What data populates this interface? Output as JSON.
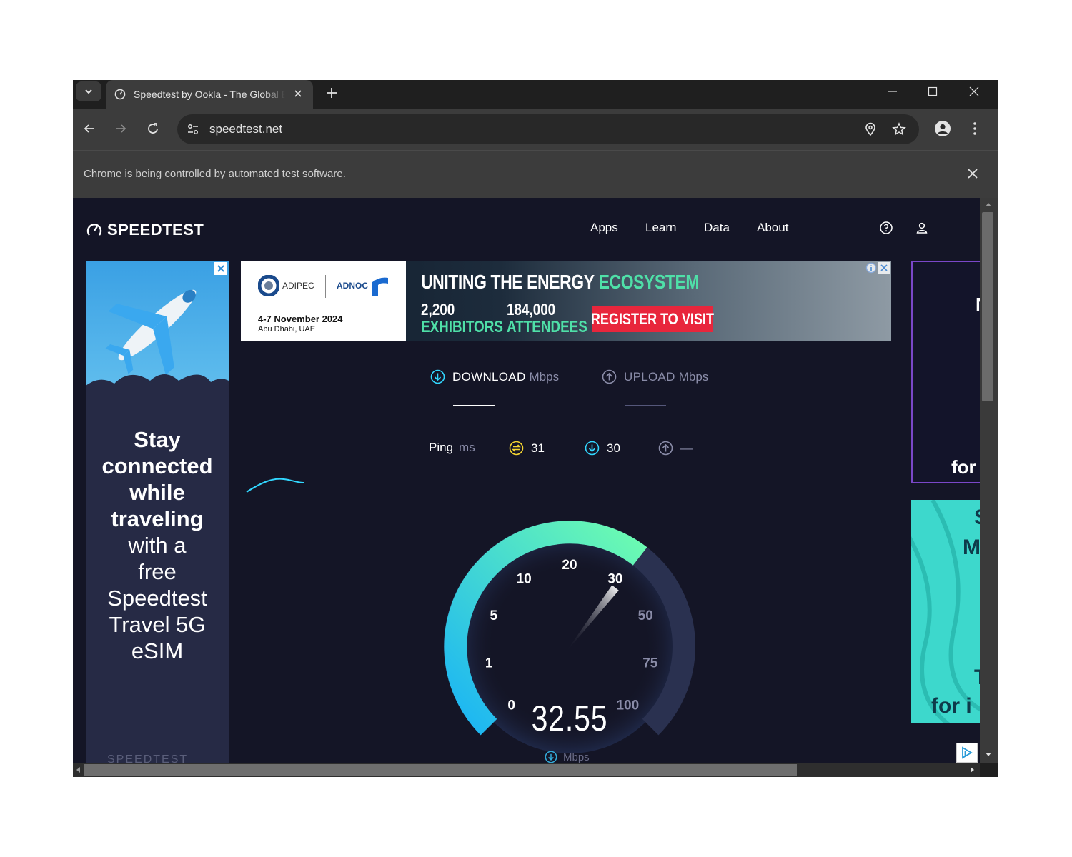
{
  "browser": {
    "tab_title": "Speedtest by Ookla - The Global Broadband Speed Test",
    "url": "speedtest.net",
    "infobar_message": "Chrome is being controlled by automated test software."
  },
  "header": {
    "logo_text": "SPEEDTEST",
    "nav": [
      "Apps",
      "Learn",
      "Data",
      "About"
    ]
  },
  "ad_left": {
    "bold_lines": [
      "Stay",
      "connected",
      "while",
      "traveling"
    ],
    "lines": [
      "with a",
      "free",
      "Speedtest",
      "Travel 5G",
      "eSIM"
    ],
    "footer": "SPEEDTEST"
  },
  "banner": {
    "brand1": "ADIPEC",
    "brand2": "ADNOC",
    "date": "4-7 November 2024",
    "city": "Abu Dhabi, UAE",
    "headline_a": "UNITING THE ENERGY",
    "headline_b": "ECOSYSTEM",
    "stat1_num": "2,200",
    "stat1_label": "EXHIBITORS",
    "stat2_num": "184,000",
    "stat2_label": "ATTENDEES",
    "cta": "REGISTER TO VISIT"
  },
  "ad_right": {
    "r1_top": "N",
    "r1_bottom": "for",
    "r2_lines": [
      "S",
      "M",
      "T",
      "for i"
    ]
  },
  "test": {
    "download_label": "DOWNLOAD",
    "upload_label": "UPLOAD",
    "unit": "Mbps",
    "ping_label": "Ping",
    "ping_unit": "ms",
    "ping_value": "31",
    "download_latency": "30",
    "upload_latency": "—"
  },
  "gauge": {
    "ticks": [
      "0",
      "1",
      "5",
      "10",
      "20",
      "30",
      "50",
      "75",
      "100"
    ],
    "value": 32.55,
    "readout": "32.55",
    "readout_unit": "Mbps",
    "colors": {
      "arc_start": "#1ab4f5",
      "arc_end": "#6dfcb0",
      "track": "#2a3150",
      "accent": "#32d7ff"
    }
  }
}
